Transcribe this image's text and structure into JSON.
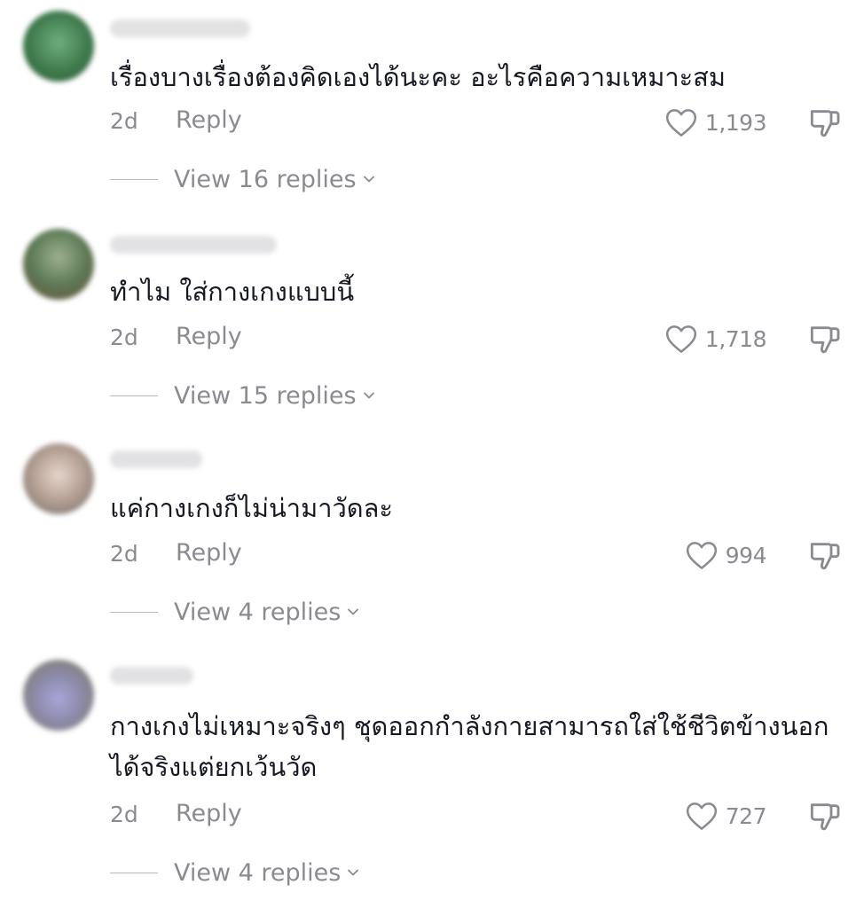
{
  "comments": [
    {
      "avatar_color": "#3f7a4c",
      "text": "เรื่องบางเรื่องต้องคิดเองได้นะคะ อะไรคือความเหมาะสม",
      "time": "2d",
      "reply_label": "Reply",
      "likes": "1,193",
      "view_replies": "View 16 replies"
    },
    {
      "avatar_color": "#5d7a56",
      "text": "ทำไม ใส่กางเกงแบบนี้",
      "time": "2d",
      "reply_label": "Reply",
      "likes": "1,718",
      "view_replies": "View 15 replies"
    },
    {
      "avatar_color": "#9a8a80",
      "text": "แค่กางเกงก็ไม่น่ามาวัดละ",
      "time": "2d",
      "reply_label": "Reply",
      "likes": "994",
      "view_replies": "View 4 replies"
    },
    {
      "avatar_color": "#8c8aa8",
      "text": "กางเกงไม่เหมาะจริงๆ ชุดออกกำลังกายสามารถใส่ใช้ชีวิตข้างนอกได้จริงแต่ยกเว้นวัด",
      "time": "2d",
      "reply_label": "Reply",
      "likes": "727",
      "view_replies": "View 4 replies"
    }
  ],
  "icons": {
    "like": "heart-outline-icon",
    "dislike": "thumbs-down-icon",
    "expand": "chevron-down-icon"
  },
  "colors": {
    "text_primary": "#161823",
    "text_secondary": "#8a8b91"
  }
}
